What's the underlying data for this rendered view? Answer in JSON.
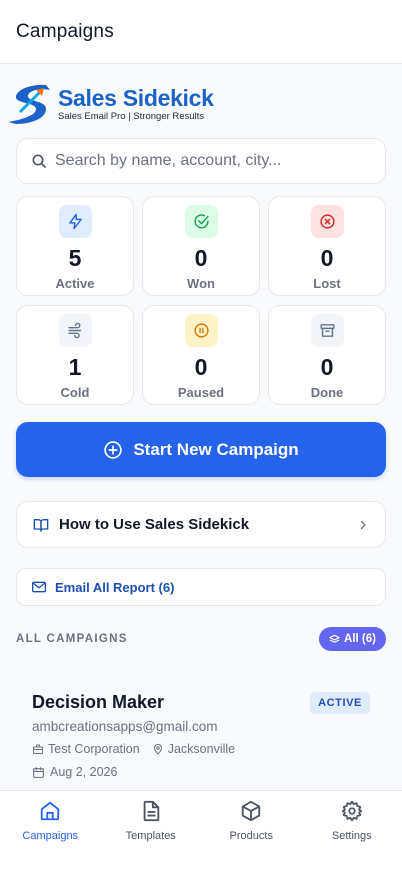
{
  "header": {
    "title": "Campaigns"
  },
  "brand": {
    "name": "Sales Sidekick",
    "tagline": "Sales Email Pro | Stronger Results"
  },
  "search": {
    "placeholder": "Search by name, account, city...",
    "value": ""
  },
  "stats": [
    {
      "value": "5",
      "label": "Active",
      "icon": "bolt-icon",
      "bg": "#e0ecfb",
      "fg": "#2563eb"
    },
    {
      "value": "0",
      "label": "Won",
      "icon": "check-circle-icon",
      "bg": "#dcfce7",
      "fg": "#16a34a"
    },
    {
      "value": "0",
      "label": "Lost",
      "icon": "x-circle-icon",
      "bg": "#fee2e2",
      "fg": "#dc2626"
    },
    {
      "value": "1",
      "label": "Cold",
      "icon": "wind-icon",
      "bg": "#f1f5f9",
      "fg": "#64748b"
    },
    {
      "value": "0",
      "label": "Paused",
      "icon": "pause-circle-icon",
      "bg": "#fef3c7",
      "fg": "#d97706"
    },
    {
      "value": "0",
      "label": "Done",
      "icon": "archive-icon",
      "bg": "#f1f5f9",
      "fg": "#64748b"
    }
  ],
  "actions": {
    "start_campaign": "Start New Campaign",
    "how_to": "How to Use Sales Sidekick",
    "email_report": "Email All Report (6)"
  },
  "list": {
    "section_label": "ALL CAMPAIGNS",
    "filter_chip": "All (6)",
    "campaigns": [
      {
        "name": "Decision Maker",
        "status": "ACTIVE",
        "email": "ambcreationsapps@gmail.com",
        "company": "Test Corporation",
        "city": "Jacksonville",
        "date": "Aug 2, 2026"
      }
    ]
  },
  "tabs": [
    {
      "label": "Campaigns",
      "icon": "home-icon",
      "active": true
    },
    {
      "label": "Templates",
      "icon": "document-icon",
      "active": false
    },
    {
      "label": "Products",
      "icon": "box-icon",
      "active": false
    },
    {
      "label": "Settings",
      "icon": "gear-icon",
      "active": false
    }
  ],
  "colors": {
    "primary": "#2563eb",
    "chip": "#6366f1",
    "badge_bg": "#e0ecfb",
    "badge_fg": "#1e4fb3"
  }
}
